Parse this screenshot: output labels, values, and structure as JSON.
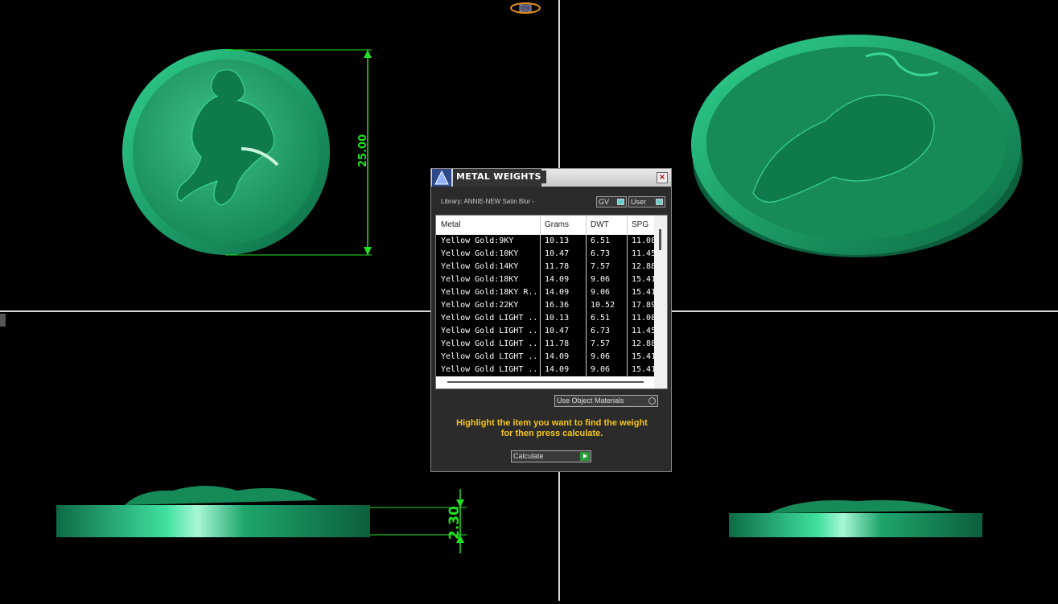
{
  "viewports": {
    "front_dimension": "25.00",
    "side_dimension": "2.30"
  },
  "dialog": {
    "title": "METAL WEIGHTS",
    "library_label": "Library: ANNIE-NEW Satin Blur -",
    "gv_dropdown": "GV",
    "user_dropdown": "User",
    "columns": [
      "Metal",
      "Grams",
      "DWT",
      "SPG"
    ],
    "rows": [
      [
        "Yellow Gold:9KY",
        "10.13",
        "6.51",
        "11.08"
      ],
      [
        "Yellow Gold:10KY",
        "10.47",
        "6.73",
        "11.45"
      ],
      [
        "Yellow Gold:14KY",
        "11.78",
        "7.57",
        "12.88"
      ],
      [
        "Yellow Gold:18KY",
        "14.09",
        "9.06",
        "15.41"
      ],
      [
        "Yellow Gold:18KY R...",
        "14.09",
        "9.06",
        "15.41"
      ],
      [
        "Yellow Gold:22KY",
        "16.36",
        "10.52",
        "17.89"
      ],
      [
        "Yellow Gold LIGHT ...",
        "10.13",
        "6.51",
        "11.08"
      ],
      [
        "Yellow Gold LIGHT ...",
        "10.47",
        "6.73",
        "11.45"
      ],
      [
        "Yellow Gold LIGHT ...",
        "11.78",
        "7.57",
        "12.88"
      ],
      [
        "Yellow Gold LIGHT ...",
        "14.09",
        "9.06",
        "15.41"
      ],
      [
        "Yellow Gold LIGHT ...",
        "14.09",
        "9.06",
        "15.41"
      ]
    ],
    "materials_dropdown": "Use Object Materials",
    "hint_line1": "Highlight the item you want to find the weight",
    "hint_line2": "for then press calculate.",
    "calculate_label": "Calculate"
  },
  "colors": {
    "model_green": "#1a9e6a",
    "dimension_green": "#22e022",
    "hint_yellow": "#f5c518"
  }
}
